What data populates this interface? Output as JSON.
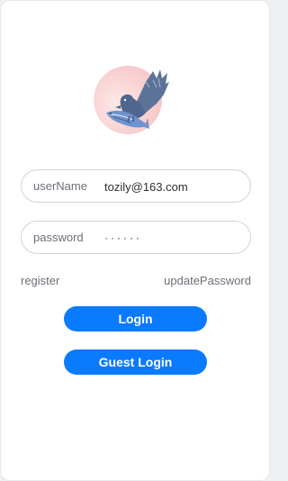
{
  "logo": {
    "icon": "eagle-fish-logo",
    "circle_color": "#f6c9c9",
    "bird_color": "#5b7399",
    "fish_color": "#5f86c8"
  },
  "form": {
    "username": {
      "label": "userName",
      "value": "tozily@163.com"
    },
    "password": {
      "label": "password",
      "value": "······"
    }
  },
  "links": {
    "register": "register",
    "update_password": "updatePassword"
  },
  "buttons": {
    "login": "Login",
    "guest_login": "Guest Login",
    "color": "#0a7aff"
  }
}
